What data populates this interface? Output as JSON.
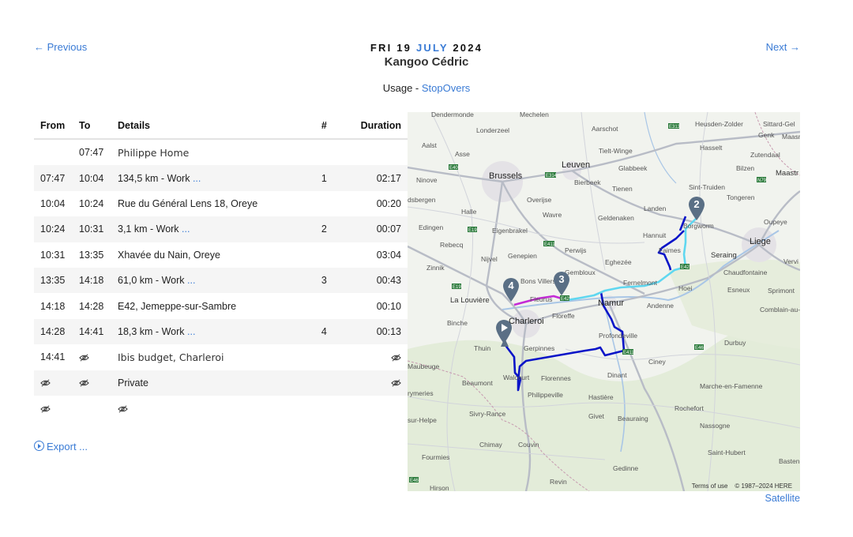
{
  "nav": {
    "previous": "← Previous",
    "next": "Next →"
  },
  "header": {
    "weekday": "FRI",
    "day": "19",
    "month": "JULY",
    "year": "2024",
    "vehicle": "Kangoo Cédric"
  },
  "subnav": {
    "usage": "Usage",
    "separator": " - ",
    "stopovers": "StopOvers"
  },
  "table": {
    "columns": [
      "From",
      "To",
      "Details",
      "#",
      "Duration"
    ],
    "rows": [
      {
        "from": "",
        "to": "07:47",
        "details": "Philippe Home",
        "link": "",
        "num": "",
        "duration": ""
      },
      {
        "from": "07:47",
        "to": "10:04",
        "details": "134,5 km - Work",
        "link": "...",
        "num": "1",
        "duration": "02:17"
      },
      {
        "from": "10:04",
        "to": "10:24",
        "details": "Rue du Général Lens 18, Oreye",
        "link": "",
        "num": "",
        "duration": "00:20"
      },
      {
        "from": "10:24",
        "to": "10:31",
        "details": "3,1 km - Work",
        "link": "...",
        "num": "2",
        "duration": "00:07"
      },
      {
        "from": "10:31",
        "to": "13:35",
        "details": "Xhavée du Nain, Oreye",
        "link": "",
        "num": "",
        "duration": "03:04"
      },
      {
        "from": "13:35",
        "to": "14:18",
        "details": "61,0 km - Work",
        "link": "...",
        "num": "3",
        "duration": "00:43"
      },
      {
        "from": "14:18",
        "to": "14:28",
        "details": "E42, Jemeppe-sur-Sambre",
        "link": "",
        "num": "",
        "duration": "00:10"
      },
      {
        "from": "14:28",
        "to": "14:41",
        "details": "18,3 km - Work",
        "link": "...",
        "num": "4",
        "duration": "00:13"
      },
      {
        "from": "14:41",
        "to": "",
        "details": "Ibis budget, Charleroi",
        "link": "",
        "num": "",
        "duration": ""
      },
      {
        "from": "",
        "to": "",
        "details": "Private",
        "link": "",
        "num": "",
        "duration": ""
      },
      {
        "from": "",
        "to": "",
        "details": "",
        "link": "",
        "num": "",
        "duration": ""
      }
    ]
  },
  "export": {
    "label": "Export ..."
  },
  "map": {
    "labels": {
      "dendermonde": "Dendermonde",
      "mechelen": "Mechelen",
      "aarschot": "Aarschot",
      "heusden_zolder": "Heusden-Zolder",
      "sittard": "Sittard-Gel",
      "londerzeel": "Londerzeel",
      "aalst": "Aalst",
      "tielt_winge": "Tielt-Winge",
      "hasselt": "Hasselt",
      "genk": "Genk",
      "asse": "Asse",
      "maasm": "Maasm",
      "zutendaal": "Zutendaal",
      "brussels": "Brussels",
      "leuven": "Leuven",
      "glabbeek": "Glabbeek",
      "bilzen": "Bilzen",
      "maastr": "Maastr",
      "geraardsbergen": "Ninove",
      "bierbeek": "Bierbeek",
      "tienen": "Tienen",
      "sint_truiden": "Sint-Truiden",
      "overijse": "Overijse",
      "tongeren": "Tongeren",
      "dsbergen": "dsbergen",
      "halle": "Halle",
      "wavre": "Wavre",
      "landen": "Landen",
      "geldenaken": "Geldenaken",
      "edingen": "Edingen",
      "eigenbrakel": "Eigenbrakel",
      "hannuit": "Hannuit",
      "borgworm": "Borgworm",
      "liege": "Liege",
      "oupeye": "Oupeye",
      "rebecq": "Rebecq",
      "perwijs": "Perwijs",
      "waremme_faimes": "Faimes",
      "seraing": "Seraing",
      "verviers": "Vervi",
      "nijvel": "Nijvel",
      "genepien": "Genepien",
      "eghezee": "Eghezée",
      "zinnik": "Zinnik",
      "gembloux": "Gembloux",
      "bons_villers": "Bons Villers",
      "fernelmont": "Fernelmont",
      "condroz": "Chaudfontaine",
      "hoei": "Hoei",
      "esneux": "Esneux",
      "sprimont": "Sprimont",
      "la_louviere": "La Louvière",
      "fleurus": "Fleurus",
      "namur": "Namur",
      "andenne": "Andenne",
      "comblain": "Comblain-au-Pon",
      "binche": "Binche",
      "charleroi": "Charleroi",
      "floreffe": "Floreffe",
      "profondeville": "Profondeville",
      "thuin": "Thuin",
      "gerpinnes": "Gerpinnes",
      "durbuy": "Durbuy",
      "maubeuge": "Maubeuge",
      "ciney": "Ciney",
      "florennes": "Florennes",
      "dinant": "Dinant",
      "beaumont": "Beaumont",
      "walcourt": "Walcourt",
      "erquelinnes": "rymeries",
      "philippeville": "Philippeville",
      "hastiere": "Hastière",
      "marche": "Marche-en-Famenne",
      "sivry": "Sivry-Rance",
      "givet": "Givet",
      "rochefort": "Rochefort",
      "sars": "sur-Helpe",
      "chimay": "Chimay",
      "couvin": "Couvin",
      "beauraing": "Beauraing",
      "nassogne": "Nassogne",
      "fourmies": "Fourmies",
      "saint_hubert": "Saint-Hubert",
      "bastogne": "Basten",
      "gedinne": "Gedinne",
      "revin": "Revin",
      "hirson": "Hirson",
      "grave": "Faimes",
      "rixensart": "Ninove"
    },
    "markers": [
      {
        "label": "2",
        "type": "numbered"
      },
      {
        "label": "3",
        "type": "numbered"
      },
      {
        "label": "4",
        "type": "numbered"
      },
      {
        "label": "",
        "type": "start"
      }
    ],
    "terms": "Terms of use",
    "copyright": "© 1987–2024 HERE",
    "colors": {
      "route_dark": "#0a14c8",
      "route_light": "#5fd7f0",
      "route_magenta": "#c42bd6",
      "pin": "#5a6f85"
    }
  },
  "satellite": {
    "label": "Satellite"
  }
}
